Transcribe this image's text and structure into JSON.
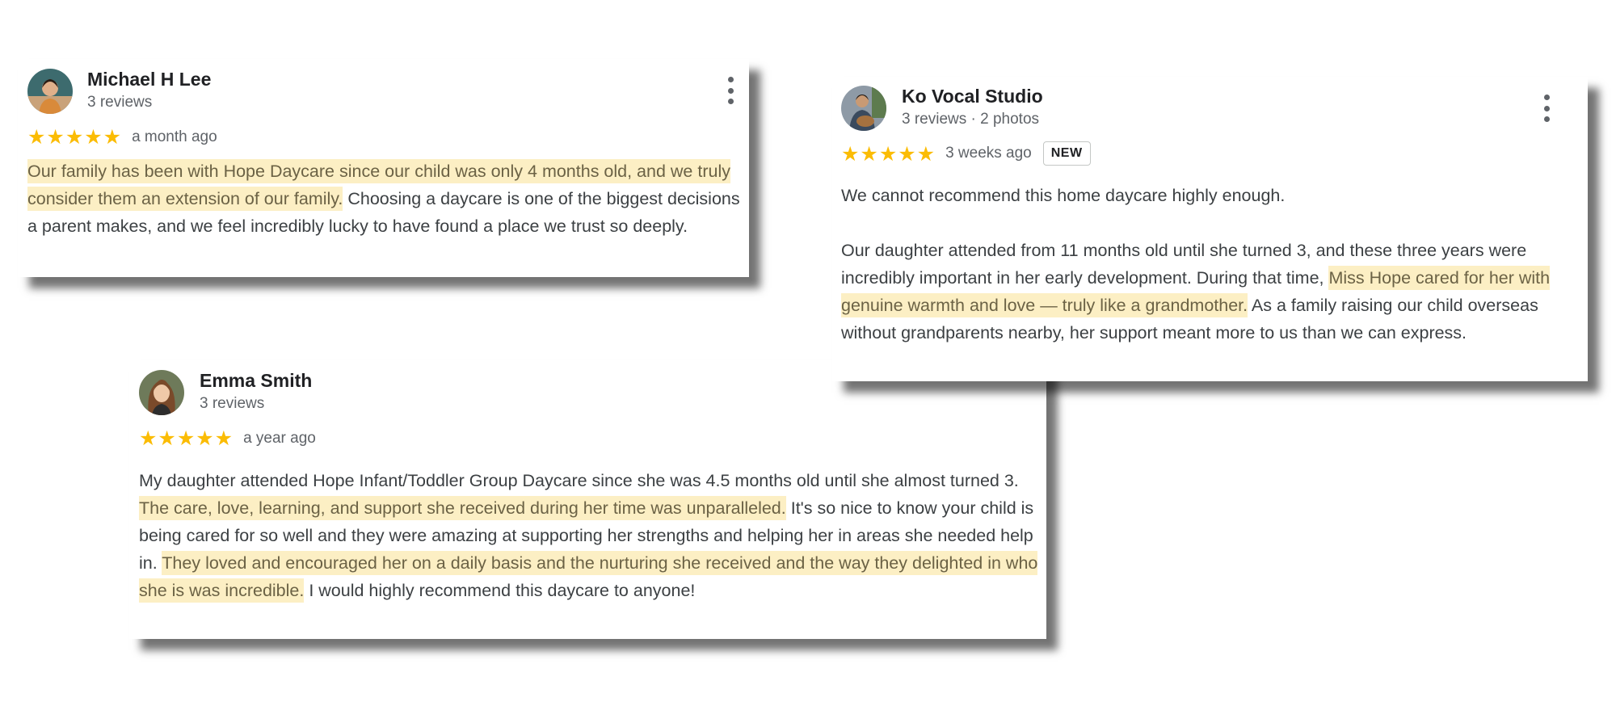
{
  "colors": {
    "star": "#fbbc04",
    "highlight": "#fcefc4",
    "text": "#3c4043",
    "muted": "#5f6368"
  },
  "reviews": [
    {
      "name": "Michael H Lee",
      "meta": "3 reviews",
      "stars": "★★★★★",
      "rating": 5,
      "time": "a month ago",
      "text": {
        "h1": "Our family has been with Hope Daycare since our child was only 4 months old, and we truly consider them an extension of our family.",
        "p1": " Choosing a daycare is one of the biggest decisions a parent makes, and we feel incredibly lucky to have found a place we trust so deeply."
      }
    },
    {
      "name": "Ko Vocal Studio",
      "meta": "3 reviews · 2 photos",
      "stars": "★★★★★",
      "rating": 5,
      "time": "3 weeks ago",
      "badge": "NEW",
      "text": {
        "p0": "We cannot recommend this home daycare highly enough.",
        "p1": "Our daughter attended from 11 months old until she turned 3, and these three years were incredibly important in her early development. During that time, ",
        "h1": "Miss Hope cared for her with genuine warmth and love — truly like a grandmother.",
        "p2": " As a family raising our child overseas without grandparents nearby, her support meant more to us than we can express."
      }
    },
    {
      "name": "Emma Smith",
      "meta": "3 reviews",
      "stars": "★★★★★",
      "rating": 5,
      "time": "a year ago",
      "text": {
        "p1": "My daughter attended Hope Infant/Toddler Group Daycare since she was 4.5 months old until she almost turned 3. ",
        "h1": "The care, love, learning, and support she received during her time was unparalleled.",
        "p2": " It's so nice to know your child is being cared for so well and they were amazing at supporting her strengths and helping her in areas she needed help in. ",
        "h2": "They loved and encouraged her on a daily basis and the nurturing she received and the way they delighted in who she is was incredible.",
        "p3": " I would highly recommend this daycare to anyone!"
      }
    }
  ]
}
